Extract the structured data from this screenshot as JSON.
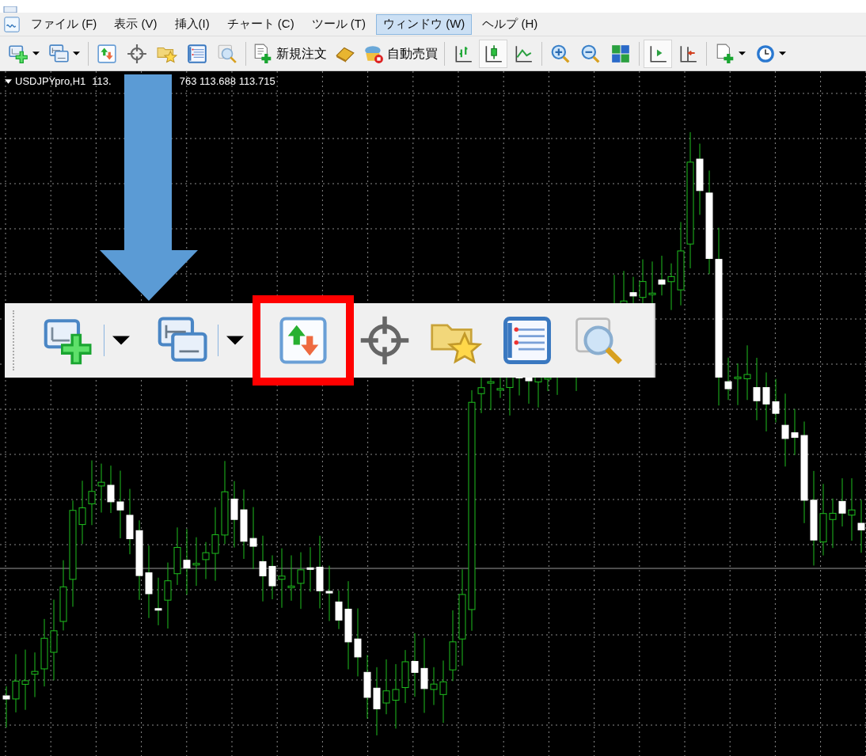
{
  "menu_bar": {
    "items": [
      {
        "label": "ファイル (F)",
        "selected": false
      },
      {
        "label": "表示 (V)",
        "selected": false
      },
      {
        "label": "挿入(I)",
        "selected": false
      },
      {
        "label": "チャート (C)",
        "selected": false
      },
      {
        "label": "ツール (T)",
        "selected": false
      },
      {
        "label": "ウィンドウ (W)",
        "selected": true
      },
      {
        "label": "ヘルプ (H)",
        "selected": false
      }
    ]
  },
  "toolbar": {
    "items": [
      {
        "kind": "icon",
        "dropdown": true,
        "selected": false
      },
      {
        "kind": "icon",
        "dropdown": true,
        "selected": false
      },
      {
        "kind": "separator"
      },
      {
        "kind": "icon",
        "dropdown": false,
        "selected": false
      },
      {
        "kind": "icon",
        "dropdown": false,
        "selected": false
      },
      {
        "kind": "icon",
        "dropdown": false,
        "selected": false
      },
      {
        "kind": "icon",
        "dropdown": false,
        "selected": false
      },
      {
        "kind": "icon",
        "dropdown": false,
        "selected": false
      },
      {
        "kind": "separator"
      },
      {
        "kind": "labeled",
        "label": "新規注文",
        "selected": false
      },
      {
        "kind": "icon",
        "dropdown": false,
        "selected": false
      },
      {
        "kind": "labeled",
        "label": "自動売買",
        "selected": false
      },
      {
        "kind": "separator"
      },
      {
        "kind": "icon",
        "dropdown": false,
        "selected": false
      },
      {
        "kind": "icon",
        "dropdown": false,
        "selected": true
      },
      {
        "kind": "icon",
        "dropdown": false,
        "selected": false
      },
      {
        "kind": "separator"
      },
      {
        "kind": "icon",
        "dropdown": false,
        "selected": false
      },
      {
        "kind": "icon",
        "dropdown": false,
        "selected": false
      },
      {
        "kind": "icon",
        "dropdown": false,
        "selected": false
      },
      {
        "kind": "separator"
      },
      {
        "kind": "icon",
        "dropdown": false,
        "selected": true
      },
      {
        "kind": "icon",
        "dropdown": false,
        "selected": false
      },
      {
        "kind": "separator"
      },
      {
        "kind": "icon",
        "dropdown": true,
        "selected": false
      },
      {
        "kind": "icon",
        "dropdown": true,
        "selected": false
      }
    ]
  },
  "chart": {
    "symbol": "USDJPYpro,H1",
    "price_visible_start": "113.",
    "price_visible_end": "763 113.688 113.715"
  },
  "zoomed_toolbar": {
    "items": [
      {
        "dropdown": true,
        "highlighted": false
      },
      {
        "dropdown": true,
        "highlighted": false
      },
      {
        "dropdown": false,
        "highlighted": true
      },
      {
        "dropdown": false,
        "highlighted": false
      },
      {
        "dropdown": false,
        "highlighted": false
      },
      {
        "dropdown": false,
        "highlighted": false
      },
      {
        "dropdown": false,
        "highlighted": false
      }
    ]
  }
}
